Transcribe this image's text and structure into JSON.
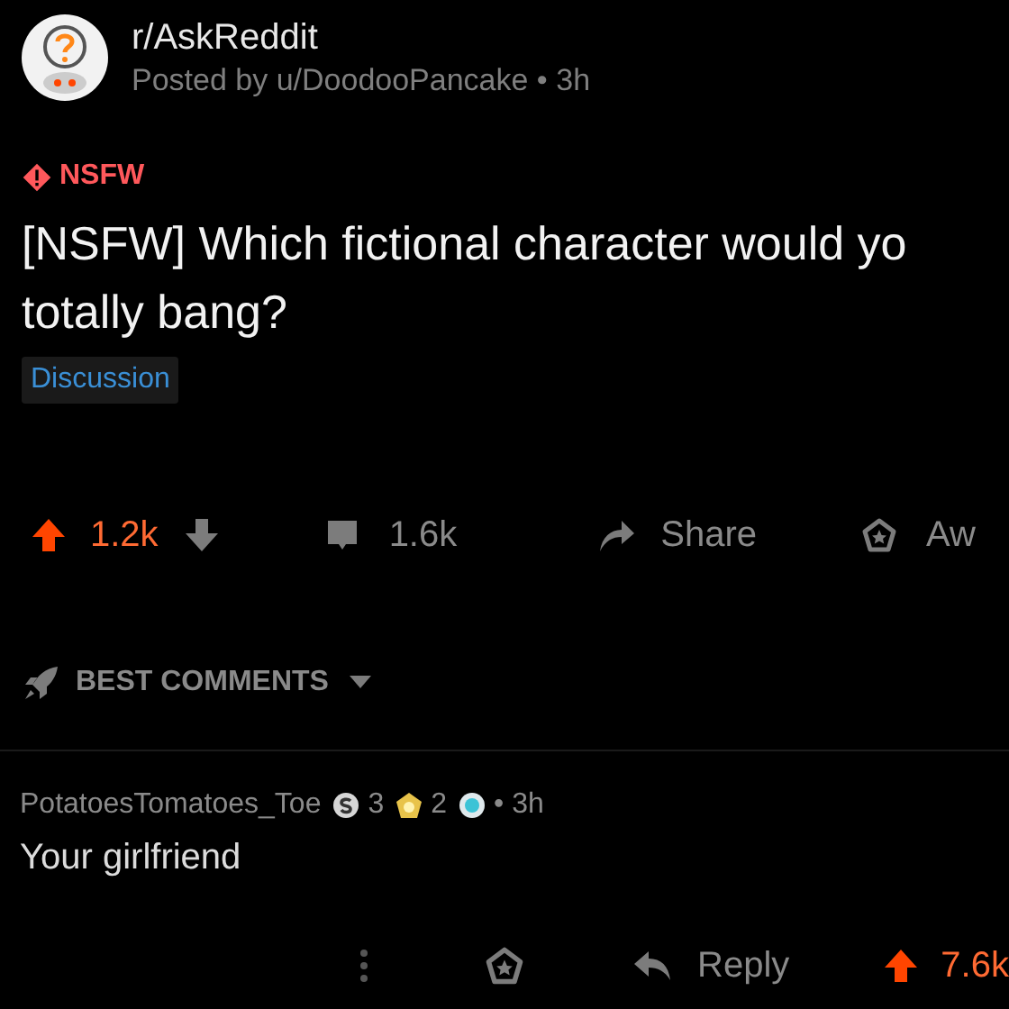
{
  "post": {
    "subreddit": "r/AskReddit",
    "byline": "Posted by u/DoodooPancake • 3h",
    "nsfw_label": "NSFW",
    "title": "[NSFW] Which fictional character would yo\ntotally bang?",
    "flair": "Discussion",
    "upvoted": true,
    "score": "1.2k",
    "comments": "1.6k",
    "share": "Share",
    "award": "Aw"
  },
  "sort": {
    "label": "BEST COMMENTS"
  },
  "comment": {
    "author": "PotatoesTomatoes_Toe",
    "awards": [
      {
        "kind": "silver",
        "count": "3"
      },
      {
        "kind": "gold",
        "count": "2"
      },
      {
        "kind": "platinum"
      }
    ],
    "time": "• 3h",
    "body": "Your girlfriend",
    "reply": "Reply",
    "upvoted": true,
    "score": "7.6k"
  }
}
